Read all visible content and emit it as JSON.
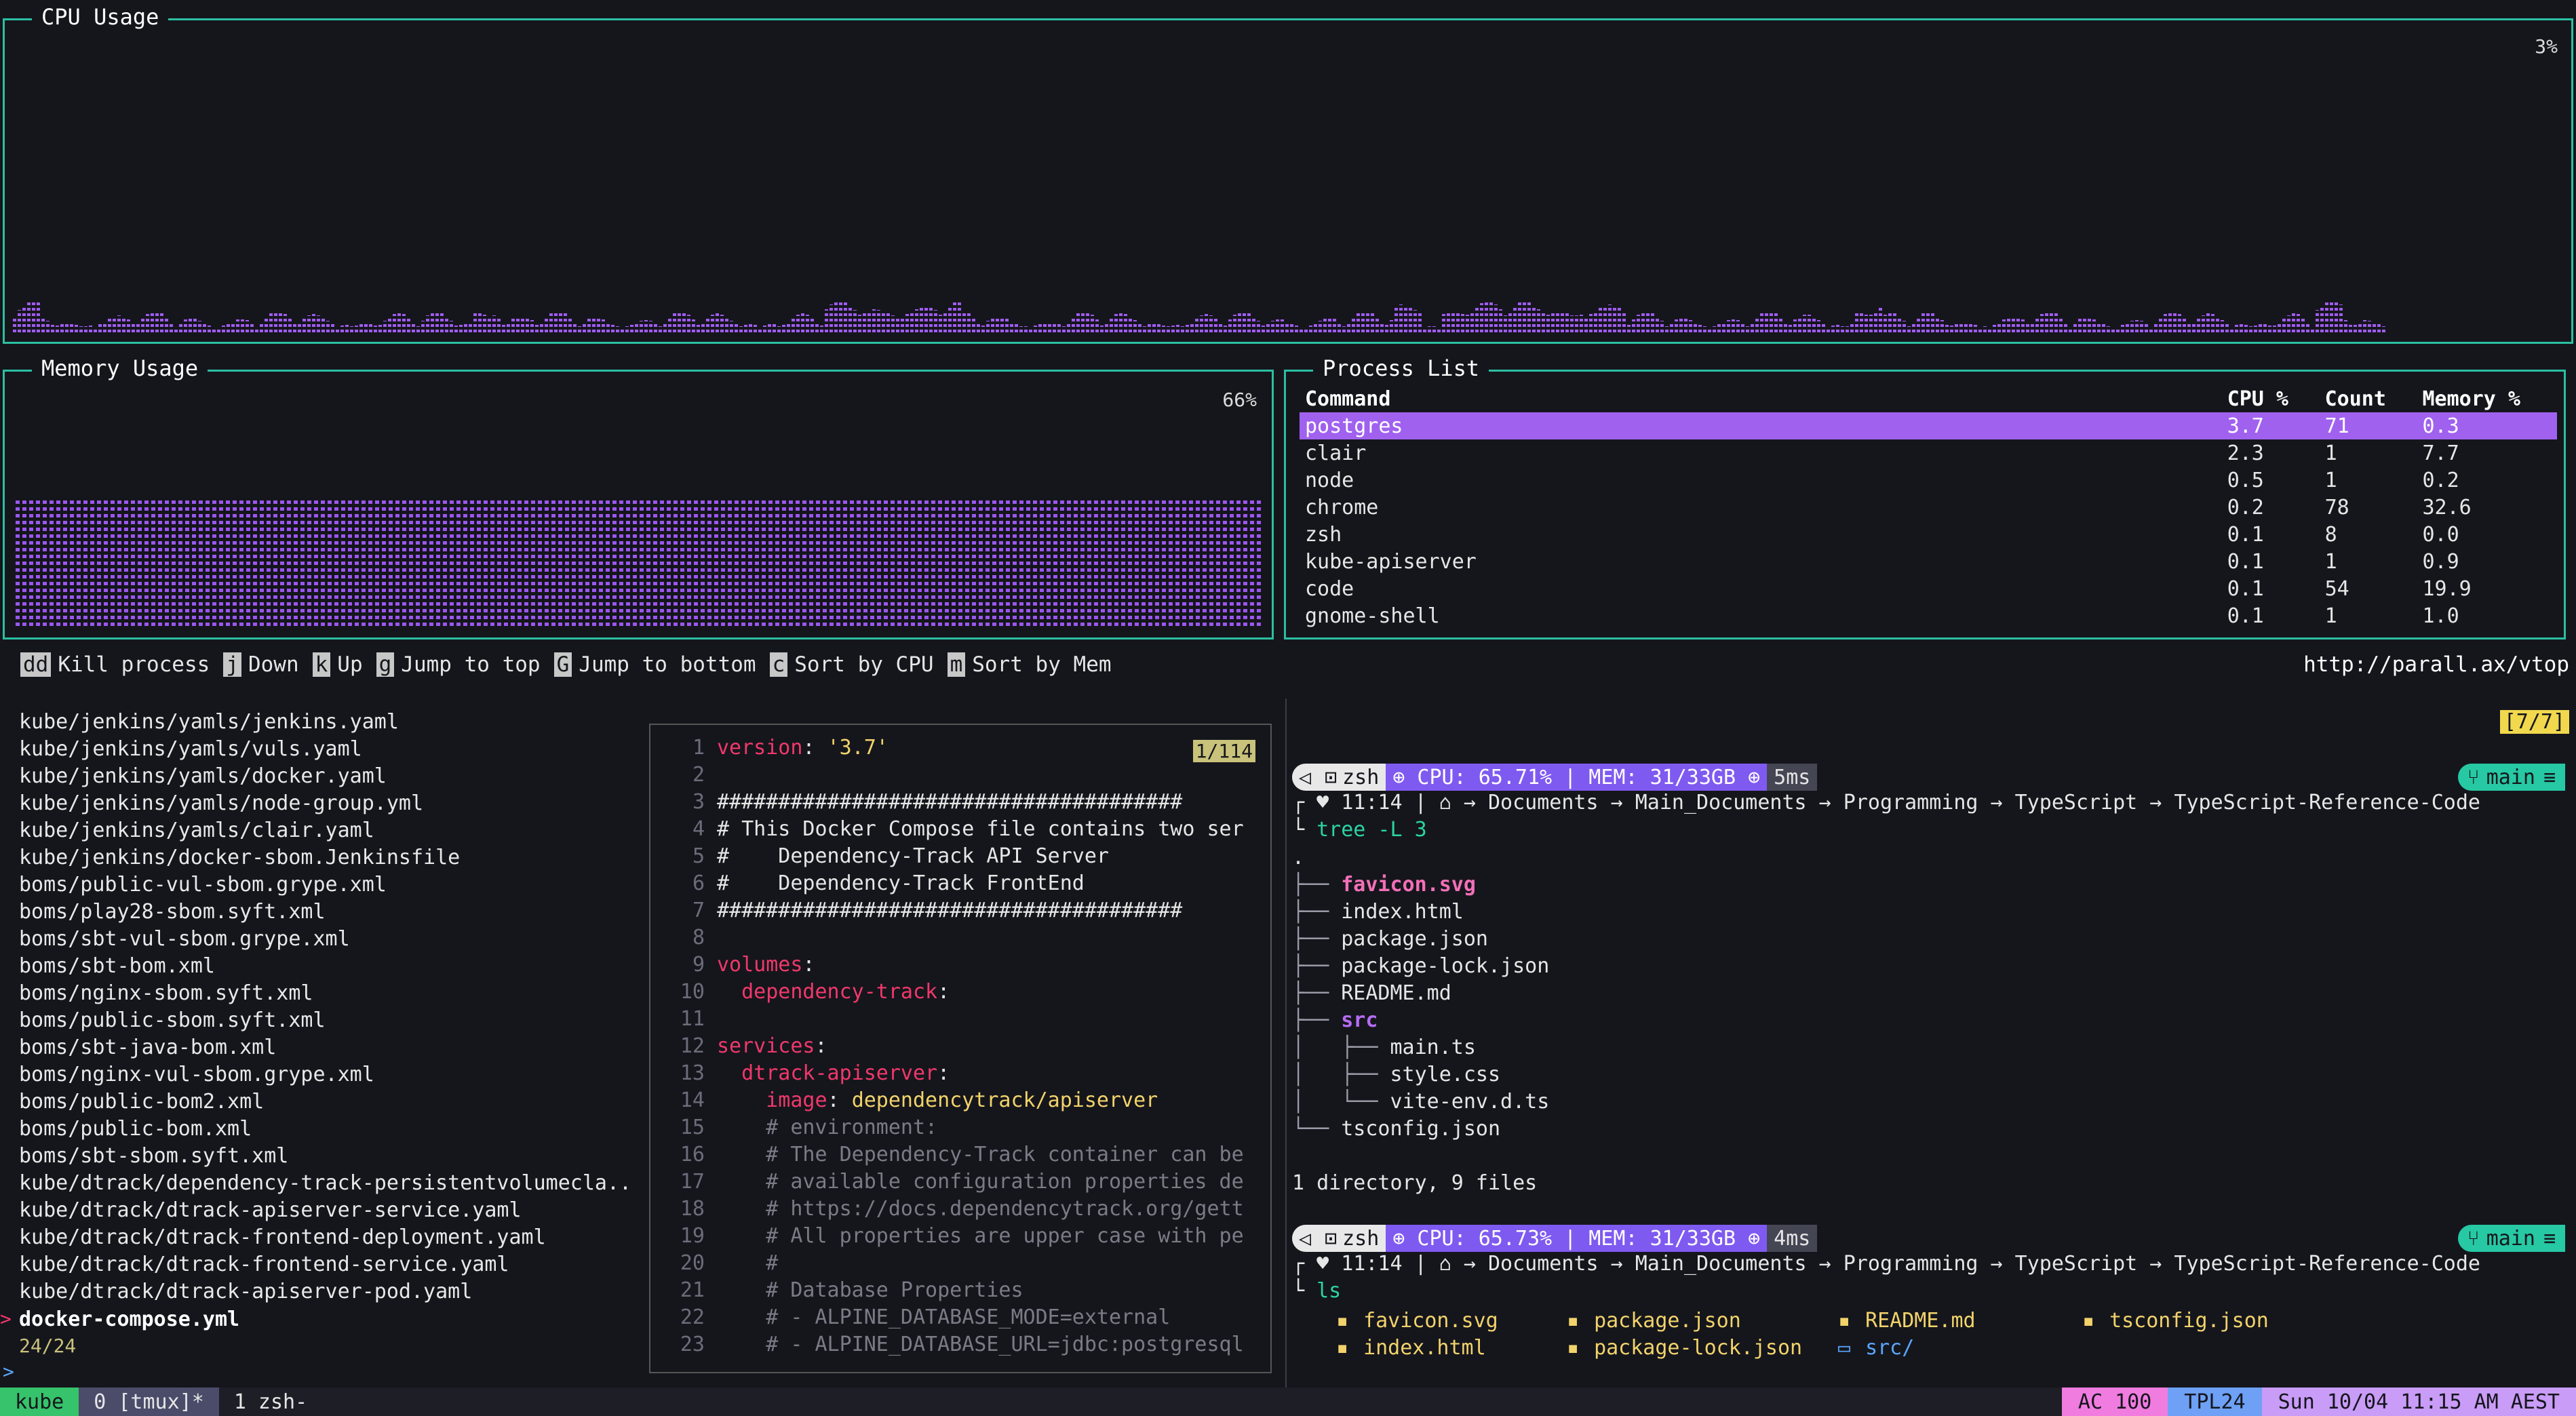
{
  "cpu": {
    "title": "CPU Usage",
    "percent": "3%"
  },
  "memory": {
    "title": "Memory Usage",
    "percent": "66%"
  },
  "process_list": {
    "title": "Process List",
    "headers": [
      "Command",
      "CPU %",
      "Count",
      "Memory %"
    ],
    "rows": [
      [
        "postgres",
        "3.7",
        "71",
        "0.3"
      ],
      [
        "clair",
        "2.3",
        "1",
        "7.7"
      ],
      [
        "node",
        "0.5",
        "1",
        "0.2"
      ],
      [
        "chrome",
        "0.2",
        "78",
        "32.6"
      ],
      [
        "zsh",
        "0.1",
        "8",
        "0.0"
      ],
      [
        "kube-apiserver",
        "0.1",
        "1",
        "0.9"
      ],
      [
        "code",
        "0.1",
        "54",
        "19.9"
      ],
      [
        "gnome-shell",
        "0.1",
        "1",
        "1.0"
      ]
    ]
  },
  "keyhints": [
    {
      "key": "dd",
      "label": "Kill process"
    },
    {
      "key": "j",
      "label": "Down"
    },
    {
      "key": "k",
      "label": "Up"
    },
    {
      "key": "g",
      "label": "Jump to top"
    },
    {
      "key": "G",
      "label": "Jump to bottom"
    },
    {
      "key": "c",
      "label": "Sort by CPU"
    },
    {
      "key": "m",
      "label": "Sort by Mem"
    }
  ],
  "url": "http://parall.ax/vtop",
  "files": [
    "kube/jenkins/yamls/jenkins.yaml",
    "kube/jenkins/yamls/vuls.yaml",
    "kube/jenkins/yamls/docker.yaml",
    "kube/jenkins/yamls/node-group.yml",
    "kube/jenkins/yamls/clair.yaml",
    "kube/jenkins/docker-sbom.Jenkinsfile",
    "boms/public-vul-sbom.grype.xml",
    "boms/play28-sbom.syft.xml",
    "boms/sbt-vul-sbom.grype.xml",
    "boms/sbt-bom.xml",
    "boms/nginx-sbom.syft.xml",
    "boms/public-sbom.syft.xml",
    "boms/sbt-java-bom.xml",
    "boms/nginx-vul-sbom.grype.xml",
    "boms/public-bom2.xml",
    "boms/public-bom.xml",
    "boms/sbt-sbom.syft.xml",
    "kube/dtrack/dependency-track-persistentvolumecla..",
    "kube/dtrack/dtrack-apiserver-service.yaml",
    "kube/dtrack/dtrack-frontend-deployment.yaml",
    "kube/dtrack/dtrack-frontend-service.yaml",
    "kube/dtrack/dtrack-apiserver-pod.yaml"
  ],
  "selected_file": "docker-compose.yml",
  "file_count": "24/24",
  "preview": {
    "position": "1/114",
    "lines": [
      {
        "n": "1",
        "parts": [
          [
            "k-red",
            "version"
          ],
          [
            "k-white",
            ": "
          ],
          [
            "k-yel",
            "'3.7'"
          ]
        ]
      },
      {
        "n": "2",
        "parts": []
      },
      {
        "n": "3",
        "parts": [
          [
            "k-white",
            "######################################"
          ]
        ]
      },
      {
        "n": "4",
        "parts": [
          [
            "k-white",
            "# This Docker Compose file contains two ser"
          ]
        ]
      },
      {
        "n": "5",
        "parts": [
          [
            "k-white",
            "#    Dependency-Track API Server"
          ]
        ]
      },
      {
        "n": "6",
        "parts": [
          [
            "k-white",
            "#    Dependency-Track FrontEnd"
          ]
        ]
      },
      {
        "n": "7",
        "parts": [
          [
            "k-white",
            "######################################"
          ]
        ]
      },
      {
        "n": "8",
        "parts": []
      },
      {
        "n": "9",
        "parts": [
          [
            "k-red",
            "volumes"
          ],
          [
            "k-white",
            ":"
          ]
        ]
      },
      {
        "n": "10",
        "parts": [
          [
            "k-white",
            "  "
          ],
          [
            "k-red",
            "dependency-track"
          ],
          [
            "k-white",
            ":"
          ]
        ]
      },
      {
        "n": "11",
        "parts": []
      },
      {
        "n": "12",
        "parts": [
          [
            "k-red",
            "services"
          ],
          [
            "k-white",
            ":"
          ]
        ]
      },
      {
        "n": "13",
        "parts": [
          [
            "k-white",
            "  "
          ],
          [
            "k-red",
            "dtrack-apiserver"
          ],
          [
            "k-white",
            ":"
          ]
        ]
      },
      {
        "n": "14",
        "parts": [
          [
            "k-white",
            "    "
          ],
          [
            "k-red",
            "image"
          ],
          [
            "k-white",
            ": "
          ],
          [
            "k-yel",
            "dependencytrack/apiserver"
          ]
        ]
      },
      {
        "n": "15",
        "parts": [
          [
            "k-com",
            "    # environment:"
          ]
        ]
      },
      {
        "n": "16",
        "parts": [
          [
            "k-com",
            "    # The Dependency-Track container can be"
          ]
        ]
      },
      {
        "n": "17",
        "parts": [
          [
            "k-com",
            "    # available configuration properties de"
          ]
        ]
      },
      {
        "n": "18",
        "parts": [
          [
            "k-com",
            "    # https://docs.dependencytrack.org/gett"
          ]
        ]
      },
      {
        "n": "19",
        "parts": [
          [
            "k-com",
            "    # All properties are upper case with pe"
          ]
        ]
      },
      {
        "n": "20",
        "parts": [
          [
            "k-com",
            "    #"
          ]
        ]
      },
      {
        "n": "21",
        "parts": [
          [
            "k-com",
            "    # Database Properties"
          ]
        ]
      },
      {
        "n": "22",
        "parts": [
          [
            "k-com",
            "    # - ALPINE_DATABASE_MODE=external"
          ]
        ]
      },
      {
        "n": "23",
        "parts": [
          [
            "k-com",
            "    # - ALPINE_DATABASE_URL=jdbc:postgresql"
          ]
        ]
      }
    ]
  },
  "tab_count": "[7/7]",
  "prompt1": {
    "arrow": "◁",
    "shell": "zsh",
    "stats": "⊕ CPU: 65.71% | MEM: 31/33GB ⊕",
    "time": "5ms",
    "branch": "main"
  },
  "prompt2": {
    "arrow": "◁",
    "shell": "zsh",
    "stats": "⊕ CPU: 65.73% | MEM: 31/33GB ⊕",
    "time": "4ms",
    "branch": "main"
  },
  "dirline": "┌ ♥ 11:14 | ⌂ → Documents → Main_Documents → Programming → TypeScript → TypeScript-Reference-Code",
  "cmd1": "tree -L 3",
  "cmd2": "ls",
  "tree": {
    "root": ".",
    "lines": [
      [
        "├── ",
        "pink",
        "favicon.svg"
      ],
      [
        "├── ",
        "",
        "index.html"
      ],
      [
        "├── ",
        "",
        "package.json"
      ],
      [
        "├── ",
        "",
        "package-lock.json"
      ],
      [
        "├── ",
        "",
        "README.md"
      ],
      [
        "├── ",
        "purple",
        "src"
      ],
      [
        "│   ├── ",
        "",
        "main.ts"
      ],
      [
        "│   ├── ",
        "",
        "style.css"
      ],
      [
        "│   └── ",
        "",
        "vite-env.d.ts"
      ],
      [
        "└── ",
        "",
        "tsconfig.json"
      ]
    ],
    "summary": "1 directory, 9 files"
  },
  "ls": [
    [
      "f",
      "favicon.svg"
    ],
    [
      "f",
      "package.json"
    ],
    [
      "f",
      "README.md"
    ],
    [
      "f",
      "tsconfig.json"
    ],
    [
      "f",
      "index.html"
    ],
    [
      "f",
      "package-lock.json"
    ],
    [
      "d",
      "src/"
    ],
    [
      "",
      ""
    ]
  ],
  "statusbar": {
    "session": "kube",
    "window0": "0 [tmux]*",
    "window1": "1 zsh-",
    "ac": "AC  100",
    "tpl": "TPL24",
    "date": "Sun 10/04 11:15 AM AEST"
  }
}
